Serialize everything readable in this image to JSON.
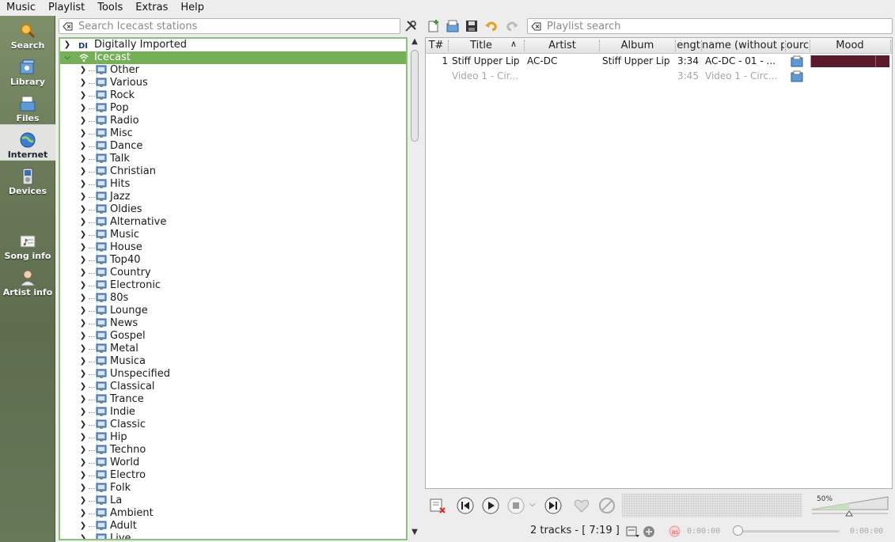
{
  "menu": [
    "Music",
    "Playlist",
    "Tools",
    "Extras",
    "Help"
  ],
  "sidebar": [
    {
      "label": "Search",
      "icon": "search-icon",
      "active": false
    },
    {
      "label": "Library",
      "icon": "library-icon",
      "active": false
    },
    {
      "label": "Files",
      "icon": "files-icon",
      "active": false
    },
    {
      "label": "Internet",
      "icon": "internet-icon",
      "active": true
    },
    {
      "label": "Devices",
      "icon": "devices-icon",
      "active": false
    },
    {
      "label": "Song info",
      "icon": "song-info-icon",
      "active": false
    },
    {
      "label": "Artist info",
      "icon": "artist-info-icon",
      "active": false
    }
  ],
  "icecast": {
    "search_placeholder": "Search Icecast stations",
    "tree": [
      {
        "label": "Digitally Imported",
        "level": 0,
        "expanded": false,
        "icon": "di-logo-icon"
      },
      {
        "label": "Icecast",
        "level": 0,
        "expanded": true,
        "selected": true,
        "icon": "icecast-icon"
      }
    ],
    "genres": [
      "Other",
      "Various",
      "Rock",
      "Pop",
      "Radio",
      "Misc",
      "Dance",
      "Talk",
      "Christian",
      "Hits",
      "Jazz",
      "Oldies",
      "Alternative",
      "Music",
      "House",
      "Top40",
      "Country",
      "Electronic",
      "80s",
      "Lounge",
      "News",
      "Gospel",
      "Metal",
      "Musica",
      "Unspecified",
      "Classical",
      "Trance",
      "Indie",
      "Classic",
      "Hip",
      "Techno",
      "World",
      "Electro",
      "Folk",
      "La",
      "Ambient",
      "Adult",
      "Live"
    ]
  },
  "playlist": {
    "search_placeholder": "Playlist search",
    "columns": [
      "T#",
      "Title",
      "Artist",
      "Album",
      "engt",
      "name (without p",
      "ourc",
      "Mood"
    ],
    "rows": [
      {
        "track": "1",
        "title": "Stiff Upper Lip",
        "artist": "AC-DC",
        "album": "Stiff Upper Lip",
        "length": "3:34",
        "filename": "AC-DC - 01 - ...",
        "dim": false
      },
      {
        "track": "",
        "title": "Video 1 - Cir...",
        "artist": "",
        "album": "",
        "length": "3:45",
        "filename": "Video 1 - Circ...",
        "dim": true
      }
    ]
  },
  "status": {
    "track_info": "2 tracks - [ 7:19 ]",
    "elapsed": "0:00:00",
    "remaining": "0:00:00",
    "volume": "50%"
  },
  "colors": {
    "selection": "#74b056",
    "tree_border": "#8bc27a",
    "sidebar": "#6a7a58"
  }
}
